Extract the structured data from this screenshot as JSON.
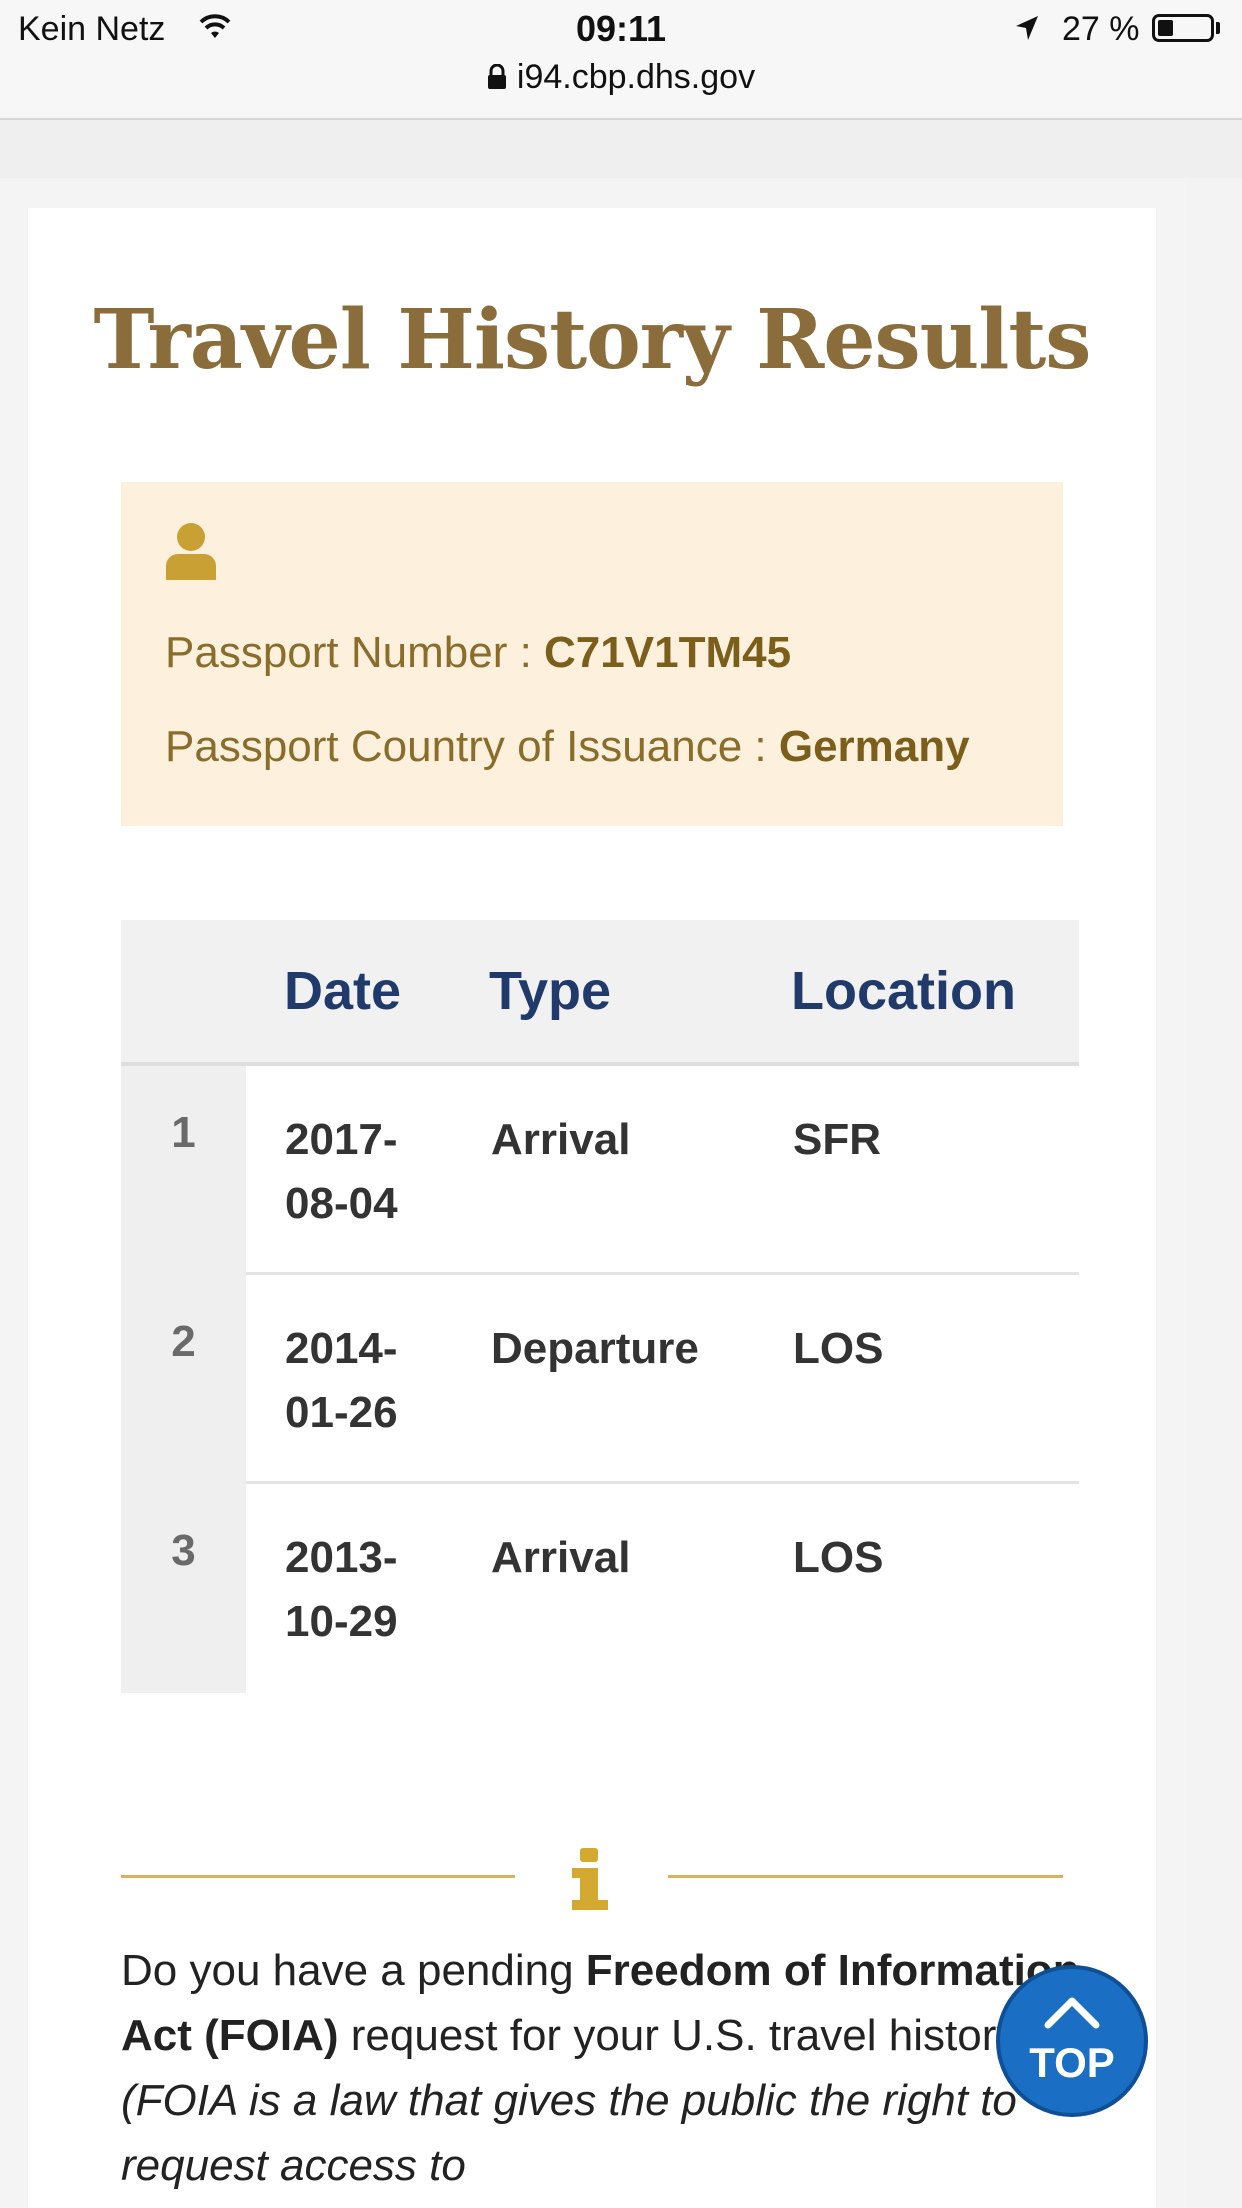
{
  "status_bar": {
    "carrier": "Kein Netz",
    "time": "09:11",
    "battery": "27 %",
    "url": "i94.cbp.dhs.gov"
  },
  "page": {
    "title": "Travel History Results"
  },
  "passport": {
    "number_label": "Passport Number : ",
    "number_value": "C71V1TM45",
    "country_label": "Passport Country of Issuance : ",
    "country_value": "Germany"
  },
  "table": {
    "headers": [
      "Date",
      "Type",
      "Location"
    ],
    "rows": [
      {
        "num": "1",
        "date": "2017-08-04",
        "type": "Arrival",
        "location": "SFR"
      },
      {
        "num": "2",
        "date": "2014-01-26",
        "type": "Departure",
        "location": "LOS"
      },
      {
        "num": "3",
        "date": "2013-10-29",
        "type": "Arrival",
        "location": "LOS"
      }
    ]
  },
  "foia": {
    "part1": "Do you have a pending ",
    "part2": "Freedom of Information Act (FOIA)",
    "part3": " request for your U.S. travel history?",
    "part4": " (FOIA is a law that gives the public the right to request access to"
  },
  "top_button": {
    "label": "TOP"
  },
  "colors": {
    "title": "#8a6d3b",
    "header_text": "#1f3a6b",
    "passport_bg": "#fdf1de",
    "gold_rule": "#d8b25c",
    "top_button": "#1a6fc4"
  }
}
